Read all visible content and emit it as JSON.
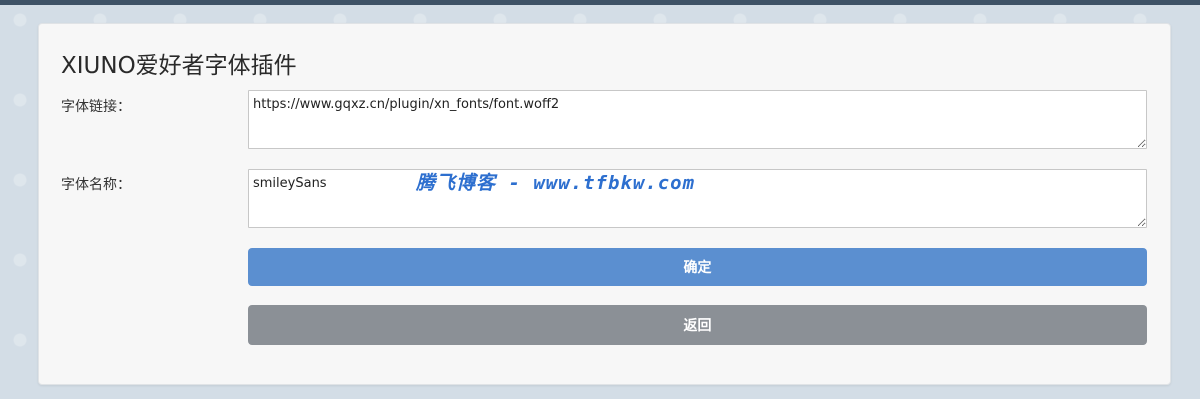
{
  "form": {
    "title": "XIUNO爱好者字体插件",
    "font_url_label": "字体链接：",
    "font_url_value": "https://www.gqxz.cn/plugin/xn_fonts/font.woff2",
    "font_name_label": "字体名称：",
    "font_name_value": "smileySans",
    "confirm_label": "确定",
    "back_label": "返回"
  },
  "watermark": {
    "text": "腾飞博客 - www.tfbkw.com"
  },
  "colors": {
    "primary_button": "#5b8fd0",
    "secondary_button": "#8b9096",
    "watermark": "#2d6fcf",
    "top_strip": "#3e5266"
  }
}
